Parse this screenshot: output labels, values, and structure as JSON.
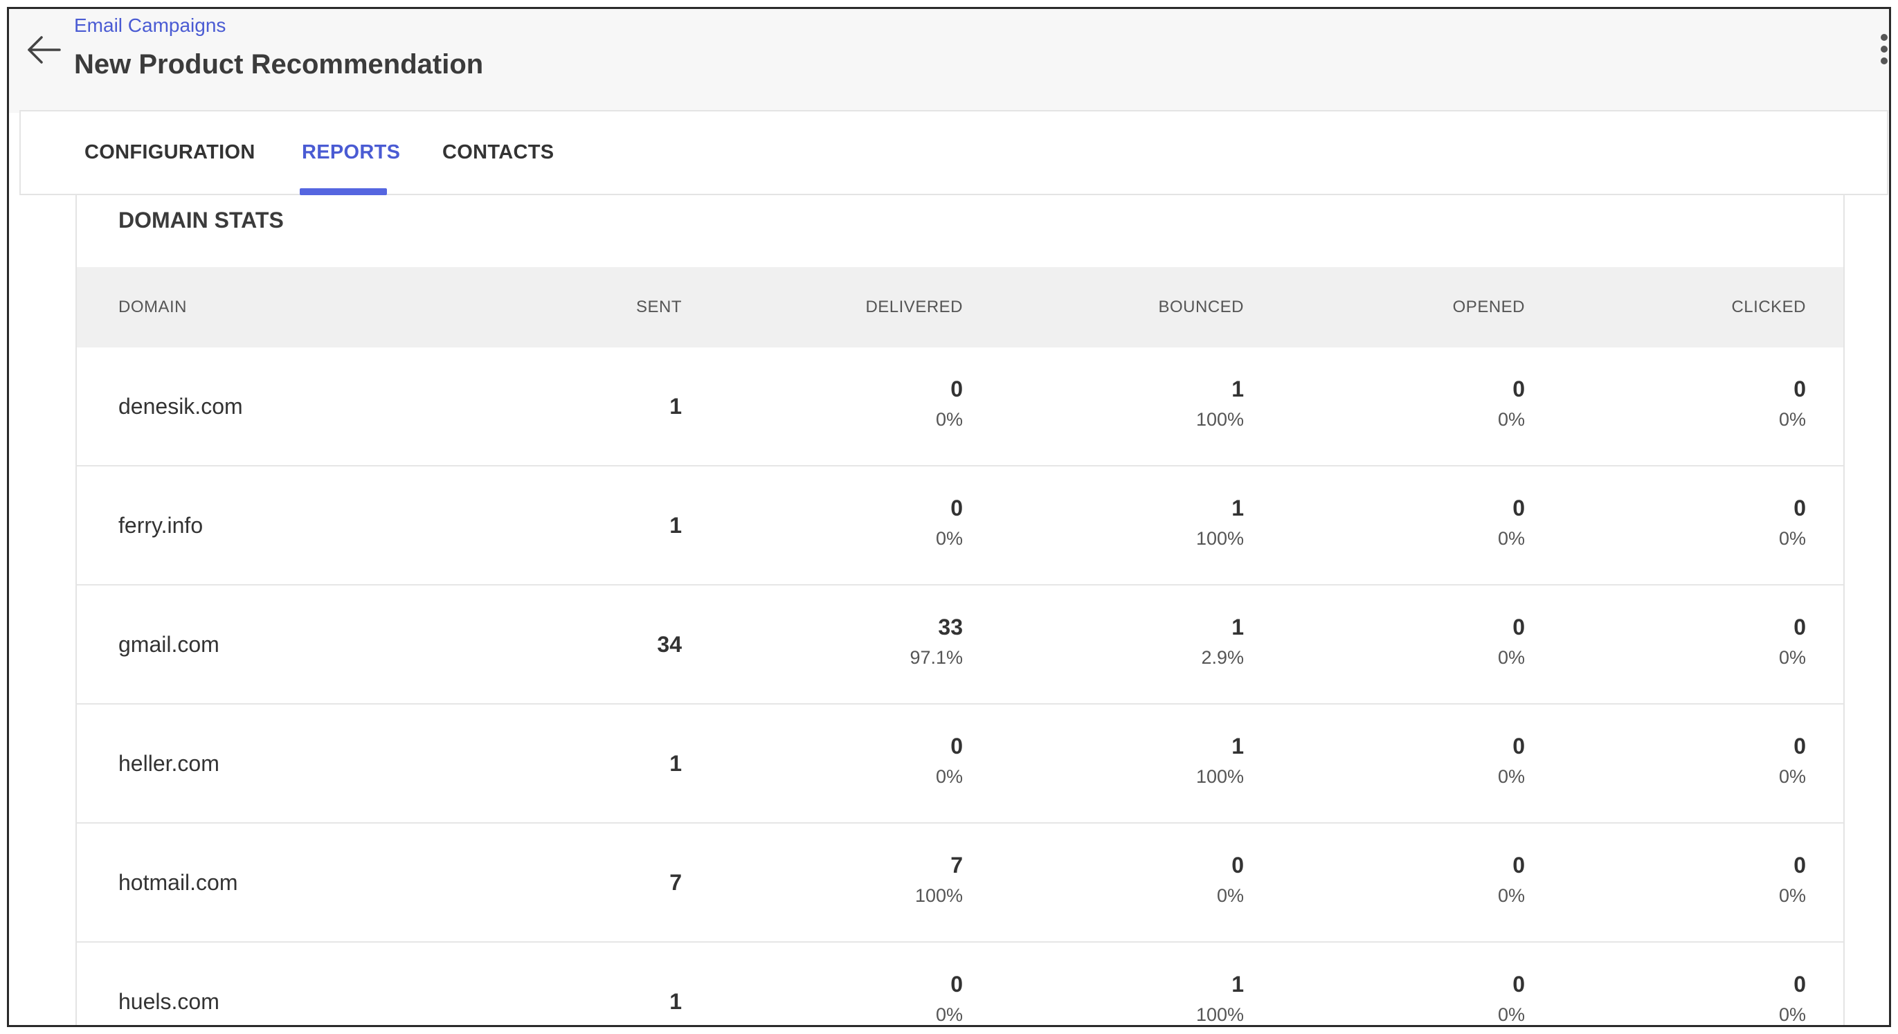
{
  "header": {
    "breadcrumb": "Email Campaigns",
    "title": "New Product Recommendation"
  },
  "tabs": [
    {
      "label": "CONFIGURATION",
      "active": false
    },
    {
      "label": "REPORTS",
      "active": true
    },
    {
      "label": "CONTACTS",
      "active": false
    }
  ],
  "colors": {
    "accent": "#4a5bd3",
    "header_bg": "#f7f7f7",
    "table_header_bg": "#f0f0f0"
  },
  "icons": {
    "back": "arrow-left-icon",
    "more": "more-vertical-icon"
  },
  "domain_stats": {
    "title": "DOMAIN STATS",
    "columns": [
      "DOMAIN",
      "SENT",
      "DELIVERED",
      "BOUNCED",
      "OPENED",
      "CLICKED"
    ],
    "rows": [
      {
        "domain": "denesik.com",
        "sent": "1",
        "delivered": {
          "n": "0",
          "pct": "0%"
        },
        "bounced": {
          "n": "1",
          "pct": "100%"
        },
        "opened": {
          "n": "0",
          "pct": "0%"
        },
        "clicked": {
          "n": "0",
          "pct": "0%"
        }
      },
      {
        "domain": "ferry.info",
        "sent": "1",
        "delivered": {
          "n": "0",
          "pct": "0%"
        },
        "bounced": {
          "n": "1",
          "pct": "100%"
        },
        "opened": {
          "n": "0",
          "pct": "0%"
        },
        "clicked": {
          "n": "0",
          "pct": "0%"
        }
      },
      {
        "domain": "gmail.com",
        "sent": "34",
        "delivered": {
          "n": "33",
          "pct": "97.1%"
        },
        "bounced": {
          "n": "1",
          "pct": "2.9%"
        },
        "opened": {
          "n": "0",
          "pct": "0%"
        },
        "clicked": {
          "n": "0",
          "pct": "0%"
        }
      },
      {
        "domain": "heller.com",
        "sent": "1",
        "delivered": {
          "n": "0",
          "pct": "0%"
        },
        "bounced": {
          "n": "1",
          "pct": "100%"
        },
        "opened": {
          "n": "0",
          "pct": "0%"
        },
        "clicked": {
          "n": "0",
          "pct": "0%"
        }
      },
      {
        "domain": "hotmail.com",
        "sent": "7",
        "delivered": {
          "n": "7",
          "pct": "100%"
        },
        "bounced": {
          "n": "0",
          "pct": "0%"
        },
        "opened": {
          "n": "0",
          "pct": "0%"
        },
        "clicked": {
          "n": "0",
          "pct": "0%"
        }
      },
      {
        "domain": "huels.com",
        "sent": "1",
        "delivered": {
          "n": "0",
          "pct": "0%"
        },
        "bounced": {
          "n": "1",
          "pct": "100%"
        },
        "opened": {
          "n": "0",
          "pct": "0%"
        },
        "clicked": {
          "n": "0",
          "pct": "0%"
        }
      }
    ]
  }
}
